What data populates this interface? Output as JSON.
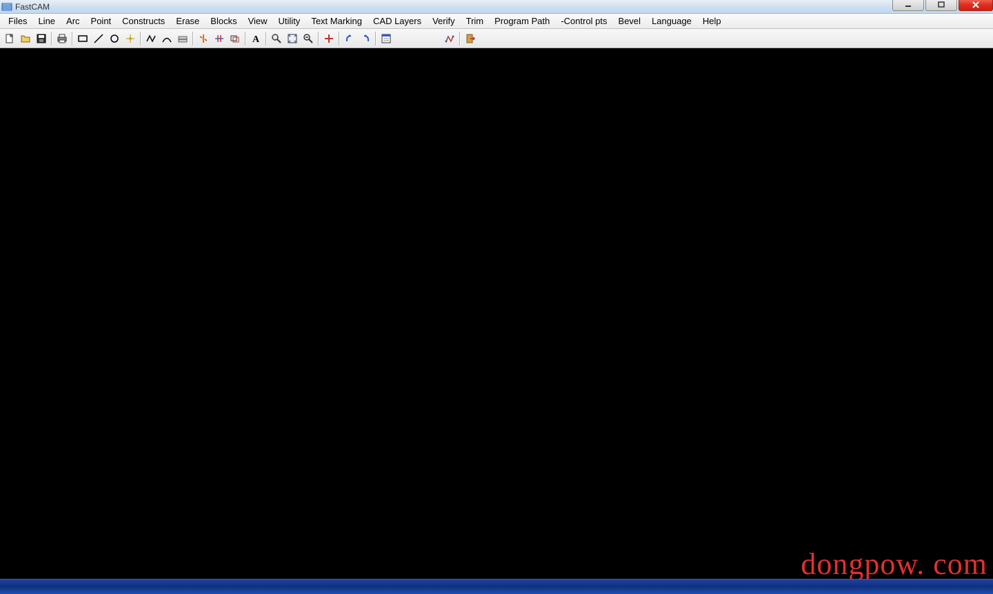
{
  "window": {
    "title": "FastCAM"
  },
  "menubar": {
    "items": [
      {
        "label": "Files"
      },
      {
        "label": "Line"
      },
      {
        "label": "Arc"
      },
      {
        "label": "Point"
      },
      {
        "label": "Constructs"
      },
      {
        "label": "Erase"
      },
      {
        "label": "Blocks"
      },
      {
        "label": "View"
      },
      {
        "label": "Utility"
      },
      {
        "label": "Text Marking"
      },
      {
        "label": "CAD Layers"
      },
      {
        "label": "Verify"
      },
      {
        "label": "Trim"
      },
      {
        "label": "Program Path"
      },
      {
        "label": "-Control pts"
      },
      {
        "label": "Bevel"
      },
      {
        "label": "Language"
      },
      {
        "label": "Help"
      }
    ]
  },
  "toolbar": {
    "buttons": [
      {
        "name": "new-icon"
      },
      {
        "name": "open-icon"
      },
      {
        "name": "save-icon"
      },
      {
        "name": "sep"
      },
      {
        "name": "print-icon"
      },
      {
        "name": "sep"
      },
      {
        "name": "rectangle-icon"
      },
      {
        "name": "line-icon"
      },
      {
        "name": "circle-icon"
      },
      {
        "name": "point-icon"
      },
      {
        "name": "sep"
      },
      {
        "name": "polyline-icon"
      },
      {
        "name": "arc-icon"
      },
      {
        "name": "fillet-icon"
      },
      {
        "name": "sep"
      },
      {
        "name": "explode-icon"
      },
      {
        "name": "trim-icon"
      },
      {
        "name": "offset-icon"
      },
      {
        "name": "sep"
      },
      {
        "name": "text-icon"
      },
      {
        "name": "sep"
      },
      {
        "name": "zoom-window-icon"
      },
      {
        "name": "zoom-extents-icon"
      },
      {
        "name": "zoom-out-icon"
      },
      {
        "name": "sep"
      },
      {
        "name": "crosshair-icon"
      },
      {
        "name": "sep"
      },
      {
        "name": "undo-icon"
      },
      {
        "name": "redo-icon"
      },
      {
        "name": "sep"
      },
      {
        "name": "properties-icon"
      },
      {
        "name": "spacer"
      },
      {
        "name": "spacer"
      },
      {
        "name": "path-icon"
      },
      {
        "name": "sep"
      },
      {
        "name": "exit-icon"
      }
    ]
  },
  "watermark": {
    "text": "dongpow. com"
  }
}
